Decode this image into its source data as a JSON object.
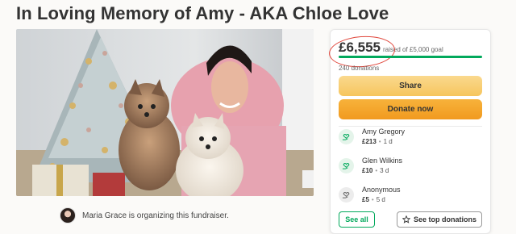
{
  "page": {
    "title": "In Loving Memory of Amy - AKA Chloe Love"
  },
  "organizer": {
    "text": "Maria Grace is organizing this fundraiser."
  },
  "donation_card": {
    "raised_amount": "£6,555",
    "raised_label": "raised of £5,000 goal",
    "progress_fraction": 1.0,
    "donations_count": "240 donations",
    "share_label": "Share",
    "donate_label": "Donate now",
    "donors": [
      {
        "name": "Amy Gregory",
        "amount": "£213",
        "time": "1 d",
        "icon": "heart-hand-icon"
      },
      {
        "name": "Glen Wilkins",
        "amount": "£10",
        "time": "3 d",
        "icon": "heart-hand-icon"
      },
      {
        "name": "Anonymous",
        "amount": "£5",
        "time": "5 d",
        "icon": "heart-hand-icon"
      }
    ],
    "see_all_label": "See all",
    "top_donations_label": "See top donations"
  },
  "colors": {
    "accent_green": "#02a95c",
    "share_yellow": "#f6c55d",
    "donate_orange": "#f19a1f",
    "annotation_red": "#e0453a"
  }
}
